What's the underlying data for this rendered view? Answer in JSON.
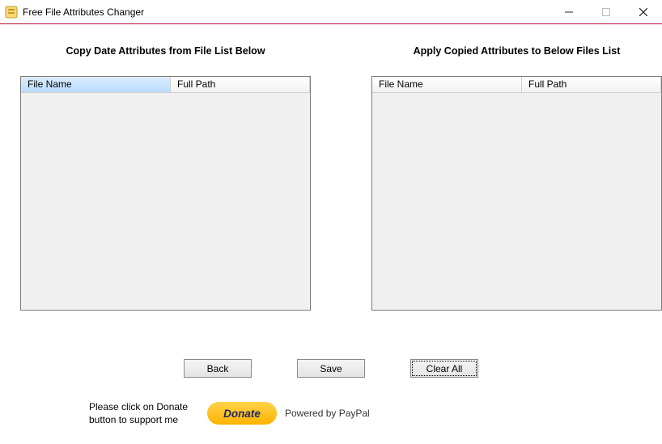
{
  "title": "Free File Attributes Changer",
  "sections": {
    "left_header": "Copy Date Attributes from File List Below",
    "right_header": "Apply Copied Attributes to Below Files List"
  },
  "columns": {
    "file_name": "File Name",
    "full_path": "Full Path"
  },
  "buttons": {
    "back": "Back",
    "save": "Save",
    "clear_all": "Clear All"
  },
  "donate": {
    "prompt": "Please click on Donate button to support me",
    "button_label": "Donate",
    "powered_by": "Powered by PayPal"
  }
}
